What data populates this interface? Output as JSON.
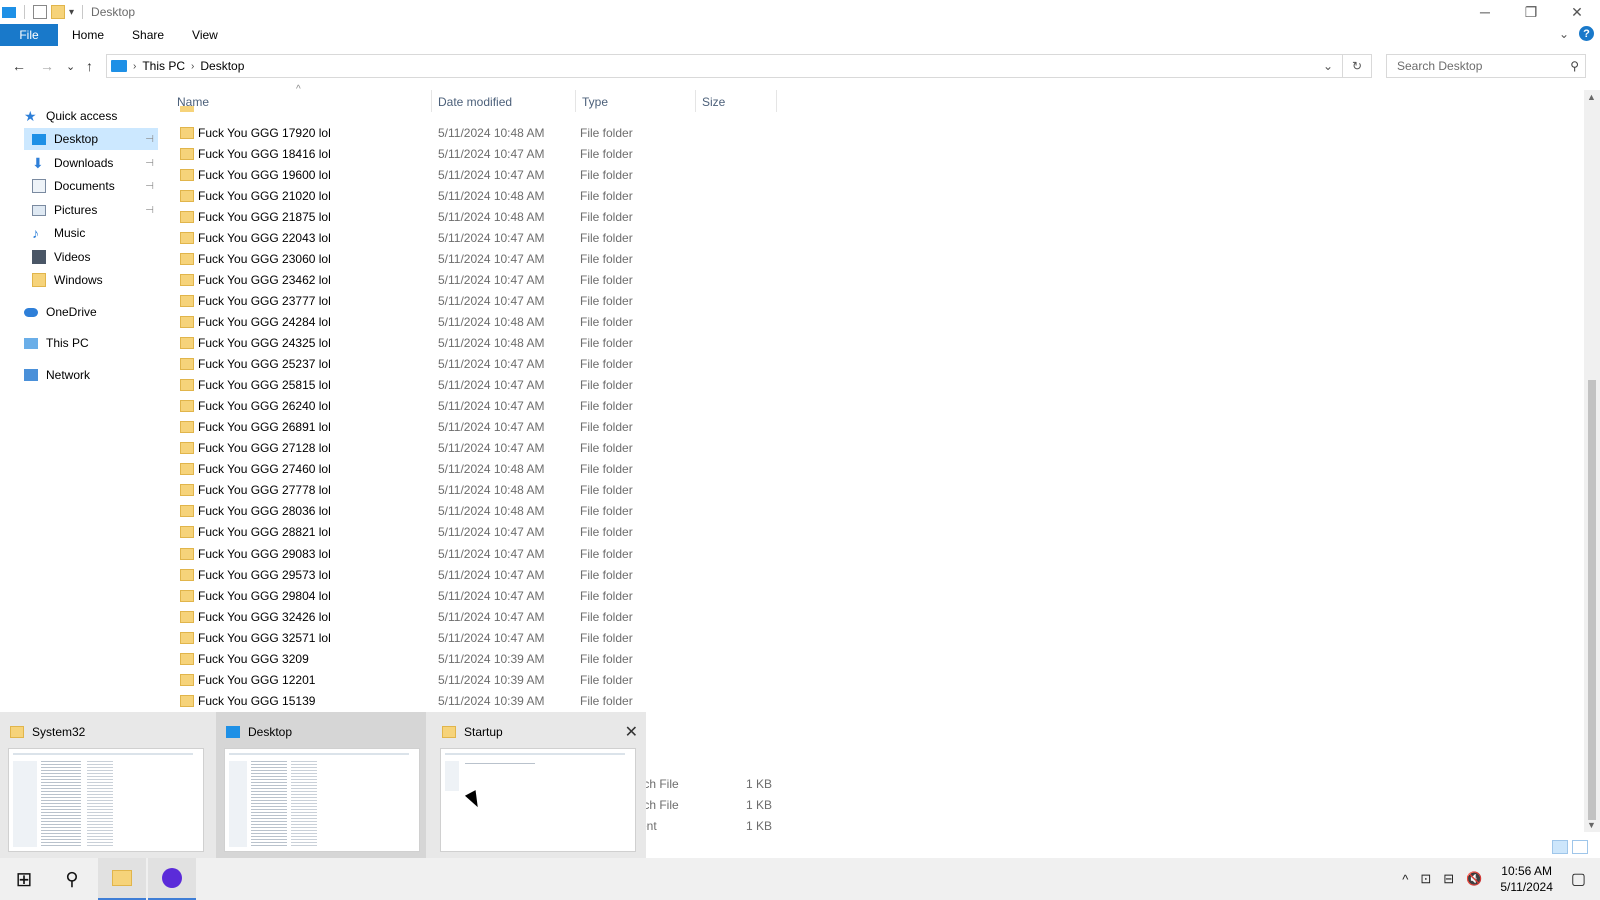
{
  "window": {
    "title": "Desktop",
    "controls": {
      "minimize": "─",
      "restore": "❐",
      "close": "✕"
    }
  },
  "ribbon": {
    "tabs": [
      "File",
      "Home",
      "Share",
      "View"
    ],
    "expand_glyph": "⌄",
    "help_glyph": "?"
  },
  "navigation": {
    "back": "←",
    "forward": "→",
    "recent": "⌄",
    "up": "↑",
    "breadcrumb": [
      "This PC",
      "Desktop"
    ],
    "breadcrumb_sep": "›",
    "dropdown": "⌄",
    "refresh": "↻",
    "search_placeholder": "Search Desktop",
    "search_glyph": "⚲"
  },
  "sidebar": {
    "items": [
      {
        "label": "Quick access",
        "icon": "star-icon",
        "pinned": false,
        "selected": false
      },
      {
        "label": "Desktop",
        "icon": "desktop-icon",
        "pinned": true,
        "selected": true
      },
      {
        "label": "Downloads",
        "icon": "download-icon",
        "pinned": true,
        "selected": false
      },
      {
        "label": "Documents",
        "icon": "documents-icon",
        "pinned": true,
        "selected": false
      },
      {
        "label": "Pictures",
        "icon": "pictures-icon",
        "pinned": true,
        "selected": false
      },
      {
        "label": "Music",
        "icon": "music-icon",
        "pinned": false,
        "selected": false
      },
      {
        "label": "Videos",
        "icon": "videos-icon",
        "pinned": false,
        "selected": false
      },
      {
        "label": "Windows",
        "icon": "folder-icon",
        "pinned": false,
        "selected": false
      },
      {
        "label": "OneDrive",
        "icon": "cloud-icon",
        "pinned": false,
        "selected": false
      },
      {
        "label": "This PC",
        "icon": "computer-icon",
        "pinned": false,
        "selected": false
      },
      {
        "label": "Network",
        "icon": "network-icon",
        "pinned": false,
        "selected": false
      }
    ],
    "pin_glyph": "⊣"
  },
  "file_list": {
    "columns": [
      "Name",
      "Date modified",
      "Type",
      "Size"
    ],
    "sort_glyph": "^",
    "rows": [
      {
        "name": "Fuck You  GGG 17920 lol",
        "date": "5/11/2024 10:48 AM",
        "type": "File folder"
      },
      {
        "name": "Fuck You  GGG 18416 lol",
        "date": "5/11/2024 10:47 AM",
        "type": "File folder"
      },
      {
        "name": "Fuck You  GGG 19600 lol",
        "date": "5/11/2024 10:47 AM",
        "type": "File folder"
      },
      {
        "name": "Fuck You  GGG 21020 lol",
        "date": "5/11/2024 10:48 AM",
        "type": "File folder"
      },
      {
        "name": "Fuck You  GGG 21875 lol",
        "date": "5/11/2024 10:48 AM",
        "type": "File folder"
      },
      {
        "name": "Fuck You  GGG 22043 lol",
        "date": "5/11/2024 10:47 AM",
        "type": "File folder"
      },
      {
        "name": "Fuck You  GGG 23060 lol",
        "date": "5/11/2024 10:47 AM",
        "type": "File folder"
      },
      {
        "name": "Fuck You  GGG 23462 lol",
        "date": "5/11/2024 10:47 AM",
        "type": "File folder"
      },
      {
        "name": "Fuck You  GGG 23777 lol",
        "date": "5/11/2024 10:47 AM",
        "type": "File folder"
      },
      {
        "name": "Fuck You  GGG 24284 lol",
        "date": "5/11/2024 10:48 AM",
        "type": "File folder"
      },
      {
        "name": "Fuck You  GGG 24325 lol",
        "date": "5/11/2024 10:48 AM",
        "type": "File folder"
      },
      {
        "name": "Fuck You  GGG 25237 lol",
        "date": "5/11/2024 10:47 AM",
        "type": "File folder"
      },
      {
        "name": "Fuck You  GGG 25815 lol",
        "date": "5/11/2024 10:47 AM",
        "type": "File folder"
      },
      {
        "name": "Fuck You  GGG 26240 lol",
        "date": "5/11/2024 10:47 AM",
        "type": "File folder"
      },
      {
        "name": "Fuck You  GGG 26891 lol",
        "date": "5/11/2024 10:47 AM",
        "type": "File folder"
      },
      {
        "name": "Fuck You  GGG 27128 lol",
        "date": "5/11/2024 10:47 AM",
        "type": "File folder"
      },
      {
        "name": "Fuck You  GGG 27460 lol",
        "date": "5/11/2024 10:48 AM",
        "type": "File folder"
      },
      {
        "name": "Fuck You  GGG 27778 lol",
        "date": "5/11/2024 10:48 AM",
        "type": "File folder"
      },
      {
        "name": "Fuck You  GGG 28036 lol",
        "date": "5/11/2024 10:48 AM",
        "type": "File folder"
      },
      {
        "name": "Fuck You  GGG 28821 lol",
        "date": "5/11/2024 10:47 AM",
        "type": "File folder"
      },
      {
        "name": "Fuck You  GGG 29083 lol",
        "date": "5/11/2024 10:47 AM",
        "type": "File folder"
      },
      {
        "name": "Fuck You  GGG 29573 lol",
        "date": "5/11/2024 10:47 AM",
        "type": "File folder"
      },
      {
        "name": "Fuck You  GGG 29804 lol",
        "date": "5/11/2024 10:47 AM",
        "type": "File folder"
      },
      {
        "name": "Fuck You  GGG 32426 lol",
        "date": "5/11/2024 10:47 AM",
        "type": "File folder"
      },
      {
        "name": "Fuck You  GGG 32571 lol",
        "date": "5/11/2024 10:47 AM",
        "type": "File folder"
      },
      {
        "name": "Fuck You GGG 3209",
        "date": "5/11/2024 10:39 AM",
        "type": "File folder"
      },
      {
        "name": "Fuck You GGG 12201",
        "date": "5/11/2024 10:39 AM",
        "type": "File folder"
      },
      {
        "name": "Fuck You GGG 15139",
        "date": "5/11/2024 10:39 AM",
        "type": "File folder"
      }
    ],
    "partial_rows": [
      {
        "type": "tch File",
        "size": "1 KB"
      },
      {
        "type": "tch File",
        "size": "1 KB"
      },
      {
        "type": "ent",
        "size": "1 KB"
      }
    ]
  },
  "thumbnails": {
    "windows": [
      {
        "title": "System32",
        "icon": "folder-icon"
      },
      {
        "title": "Desktop",
        "icon": "desktop-icon"
      },
      {
        "title": "Startup",
        "icon": "folder-icon"
      }
    ],
    "close_glyph": "✕"
  },
  "taskbar": {
    "start_glyph": "⊞",
    "search_glyph": "⚲",
    "tray_glyphs": [
      "^",
      "⊡",
      "⊟",
      "🔇"
    ],
    "time": "10:56 AM",
    "date": "5/11/2024",
    "notification_glyph": "▢"
  }
}
